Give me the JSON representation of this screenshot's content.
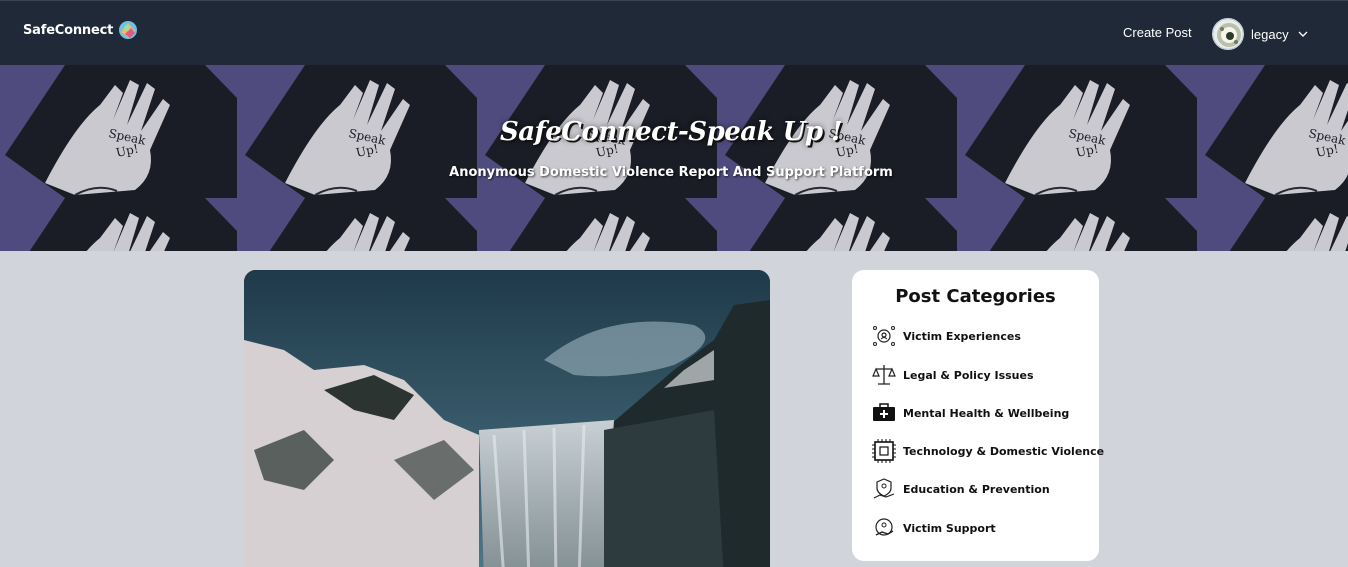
{
  "navbar": {
    "brand": "SafeConnect",
    "create_post": "Create Post",
    "username": "legacy"
  },
  "banner": {
    "title": "SafeConnect-Speak Up !",
    "subtitle": "Anonymous Domestic Violence Report And Support Platform",
    "tile_text": "Speak Up!"
  },
  "categories": {
    "title": "Post Categories",
    "items": [
      {
        "label": "Victim Experiences",
        "icon": "person-circle-icon"
      },
      {
        "label": "Legal & Policy Issues",
        "icon": "scales-icon"
      },
      {
        "label": "Mental Health & Wellbeing",
        "icon": "medical-kit-icon"
      },
      {
        "label": "Technology & Domestic Violence",
        "icon": "chip-icon"
      },
      {
        "label": "Education & Prevention",
        "icon": "shield-hand-icon"
      },
      {
        "label": "Victim Support",
        "icon": "support-hand-icon"
      }
    ]
  },
  "colors": {
    "navbar": "#1f2937",
    "page_bg": "#d1d5db",
    "banner_bg": "#4c4678"
  }
}
